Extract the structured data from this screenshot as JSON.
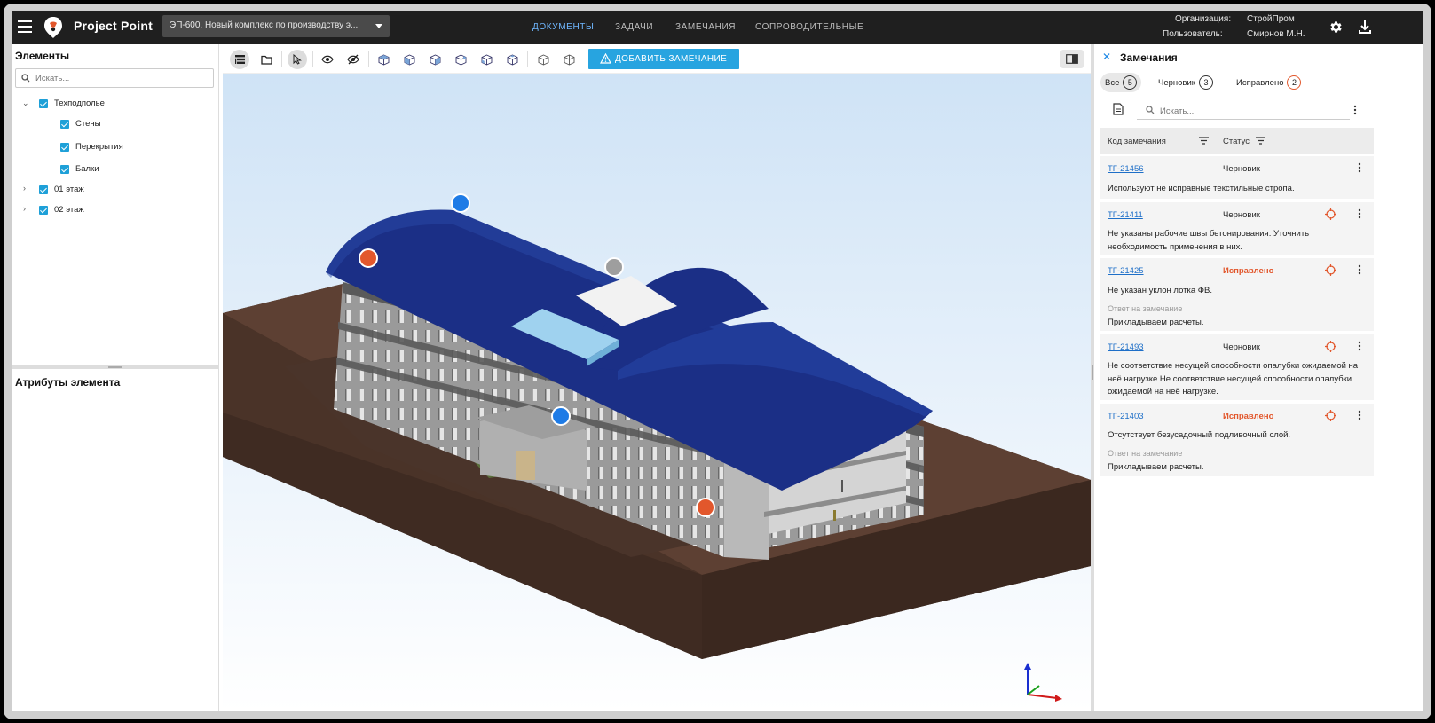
{
  "app": {
    "brand": "Project Point",
    "project": "ЭП-600. Новый комплекс по производству э...",
    "nav": [
      "ДОКУМЕНТЫ",
      "ЗАДАЧИ",
      "ЗАМЕЧАНИЯ",
      "СОПРОВОДИТЕЛЬНЫЕ"
    ],
    "active_nav": "ДОКУМЕНТЫ",
    "org_label": "Организация:",
    "org_value": "СтройПром",
    "user_label": "Пользователь:",
    "user_value": "Смирнов М.Н.",
    "accent": "#6fb7ff"
  },
  "left_panel": {
    "title": "Элементы",
    "search_placeholder": "Искать...",
    "tree": [
      {
        "label": "Техподполье",
        "expanded": true,
        "checked": true,
        "children": [
          {
            "label": "Стены",
            "checked": true
          },
          {
            "label": "Перекрытия",
            "checked": true
          },
          {
            "label": "Балки",
            "checked": true
          }
        ]
      },
      {
        "label": "01 этаж",
        "expanded": false,
        "checked": true
      },
      {
        "label": "02 этаж",
        "expanded": false,
        "checked": true
      }
    ],
    "attributes_title": "Атрибуты элемента"
  },
  "toolbar": {
    "add_issue_label": "ДОБАВИТЬ ЗАМЕЧАНИЕ",
    "icons": [
      "layers-icon",
      "folder-icon",
      "select-cursor-icon",
      "show-icon",
      "hide-icon",
      "cube-view-1-icon",
      "cube-view-2-icon",
      "cube-view-3-icon",
      "cube-view-4-icon",
      "cube-view-5-icon",
      "cube-view-6-icon",
      "section-box-icon",
      "section-plane-icon",
      "panel-layout-icon"
    ],
    "accent": "#27a4e0"
  },
  "viewport": {
    "markers": [
      {
        "color": "#1e7be6"
      },
      {
        "color": "#e2572c"
      },
      {
        "color": "#9e9e9e"
      },
      {
        "color": "#1e7be6"
      },
      {
        "color": "#e2572c"
      }
    ]
  },
  "right_panel": {
    "title": "Замечания",
    "tabs": [
      {
        "label": "Все",
        "count": "5",
        "active": true
      },
      {
        "label": "Черновик",
        "count": "3",
        "active": false
      },
      {
        "label": "Исправлено",
        "count": "2",
        "active": false
      }
    ],
    "search_placeholder": "Искать...",
    "col_code": "Код замечания",
    "col_status": "Статус",
    "reply_label": "Ответ на замечание",
    "issues": [
      {
        "code": "ТГ-21456",
        "status": "Черновик",
        "desc": "Используют не исправные текстильные стропа.",
        "reply": ""
      },
      {
        "code": "ТГ-21411",
        "status": "Черновик",
        "desc": "Не указаны рабочие швы бетонирования. Уточнить необходимость применения в них.",
        "reply": ""
      },
      {
        "code": "ТГ-21425",
        "status": "Исправлено",
        "desc": "Не указан уклон лотка ФВ.",
        "reply": "Прикладываем расчеты."
      },
      {
        "code": "ТГ-21493",
        "status": "Черновик",
        "desc": "Не соответствие несущей способности опалубки ожидаемой на неё нагрузке.Не соответствие несущей способности опалубки ожидаемой на неё нагрузке.",
        "reply": ""
      },
      {
        "code": "ТГ-21403",
        "status": "Исправлено",
        "desc": "Отсутствует безусадочный подливочный слой.",
        "reply": "Прикладываем расчеты."
      }
    ],
    "status_fixed_color": "#e2572c",
    "link_color": "#1e6fc8"
  }
}
